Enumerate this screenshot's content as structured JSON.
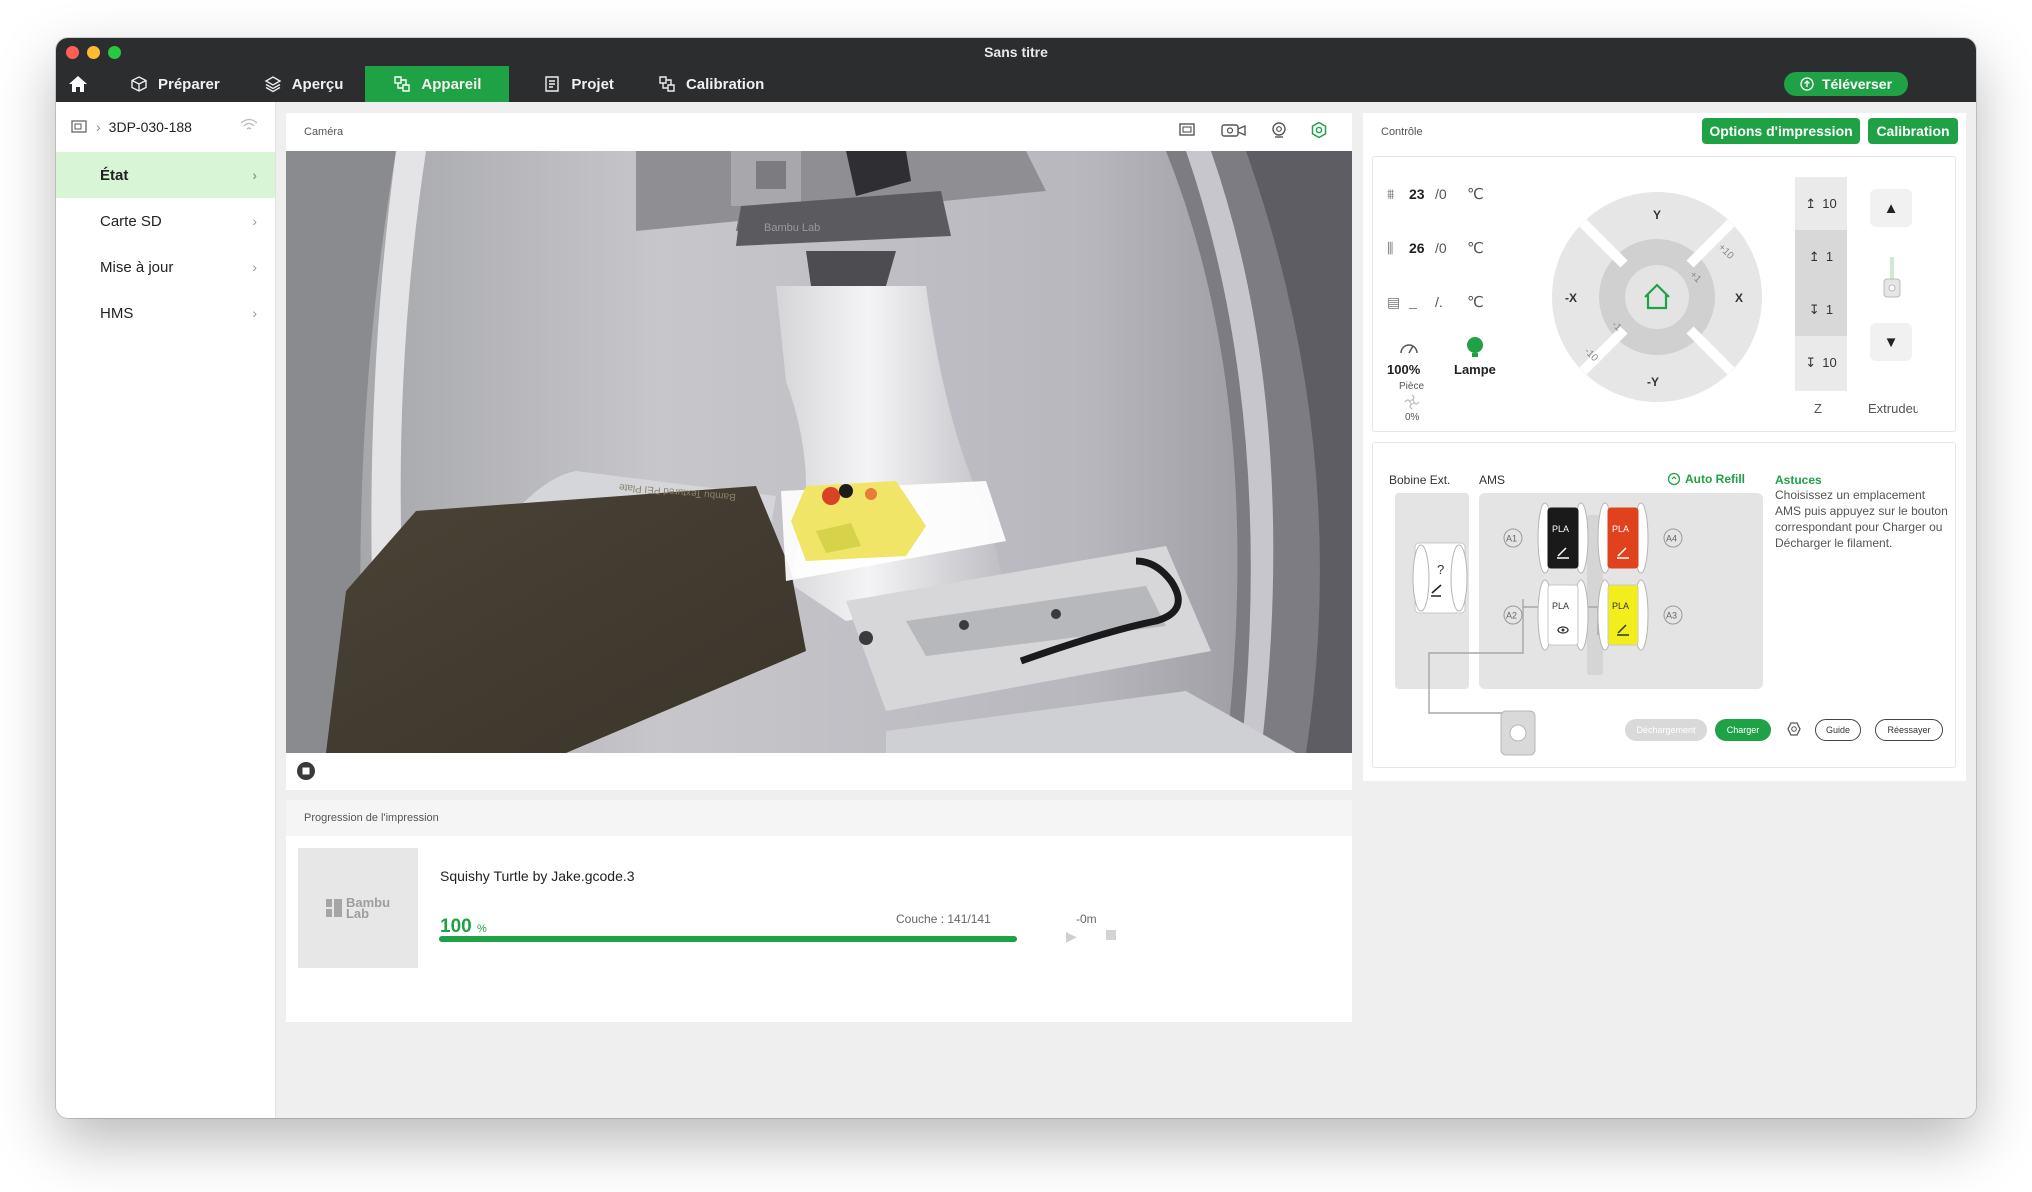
{
  "window": {
    "title": "Sans titre"
  },
  "nav": {
    "tabs": [
      {
        "label": "Préparer"
      },
      {
        "label": "Aperçu"
      },
      {
        "label": "Appareil"
      },
      {
        "label": "Projet"
      },
      {
        "label": "Calibration"
      }
    ],
    "upload_label": "Téléverser"
  },
  "sidebar": {
    "device_name": "3DP-030-188",
    "items": [
      {
        "label": "État"
      },
      {
        "label": "Carte SD"
      },
      {
        "label": "Mise à jour"
      },
      {
        "label": "HMS"
      }
    ]
  },
  "camera": {
    "title": "Caméra",
    "toolhead_text": "Bambu Lab",
    "plate_text": "Bambu Textured PEI Plate"
  },
  "progress": {
    "title": "Progression de l'impression",
    "thumb_text_1": "Bambu",
    "thumb_text_2": "Lab",
    "file_name": "Squishy Turtle by Jake.gcode.3",
    "percent": "100",
    "percent_unit": "%",
    "percent_value": 100,
    "layer": "Couche : 141/141",
    "remaining": "-0m"
  },
  "control": {
    "title": "Contrôle",
    "print_options_label": "Options d'impression",
    "calibration_label": "Calibration",
    "nozzle_temp": "23",
    "nozzle_target": "/0",
    "bed_temp": "26",
    "bed_target": "/0",
    "chamber_temp": "_",
    "chamber_target": "/.",
    "temp_unit": "℃",
    "speed": "100%",
    "lamp_label": "Lampe",
    "part_label": "Pièce",
    "part_fan": "0%",
    "jog": {
      "y_pos": "Y",
      "y_neg": "-Y",
      "x_pos": "X",
      "x_neg": "-X",
      "plus10": "+10",
      "plus1": "+1",
      "minus1": "-1",
      "minus10": "-10"
    },
    "z_buttons": [
      "10",
      "1",
      "1",
      "10"
    ],
    "z_label": "Z",
    "extruder_label": "Extrudeur"
  },
  "ams": {
    "ext_spool_label": "Bobine Ext.",
    "ams_label": "AMS",
    "auto_refill_label": "Auto Refill",
    "ext_spool_mark": "?",
    "slots": [
      {
        "id": "A1",
        "material": "PLA",
        "color": "#1a1a1a"
      },
      {
        "id": "A2",
        "material": "PLA",
        "color": "#ffffff"
      },
      {
        "id": "A3",
        "material": "PLA",
        "color": "#f2ee1c"
      },
      {
        "id": "A4",
        "material": "PLA",
        "color": "#e0421e"
      }
    ],
    "tips_title": "Astuces",
    "tips_text": "Choisissez un emplacement AMS puis appuyez sur le bouton correspondant pour Charger ou Décharger le filament.",
    "unload_label": "Déchargement",
    "load_label": "Charger",
    "guide_label": "Guide",
    "retry_label": "Réessayer"
  },
  "colors": {
    "accent": "#1fa145",
    "active_bg": "#d8f5d6",
    "topbar": "#2b2d2e"
  }
}
